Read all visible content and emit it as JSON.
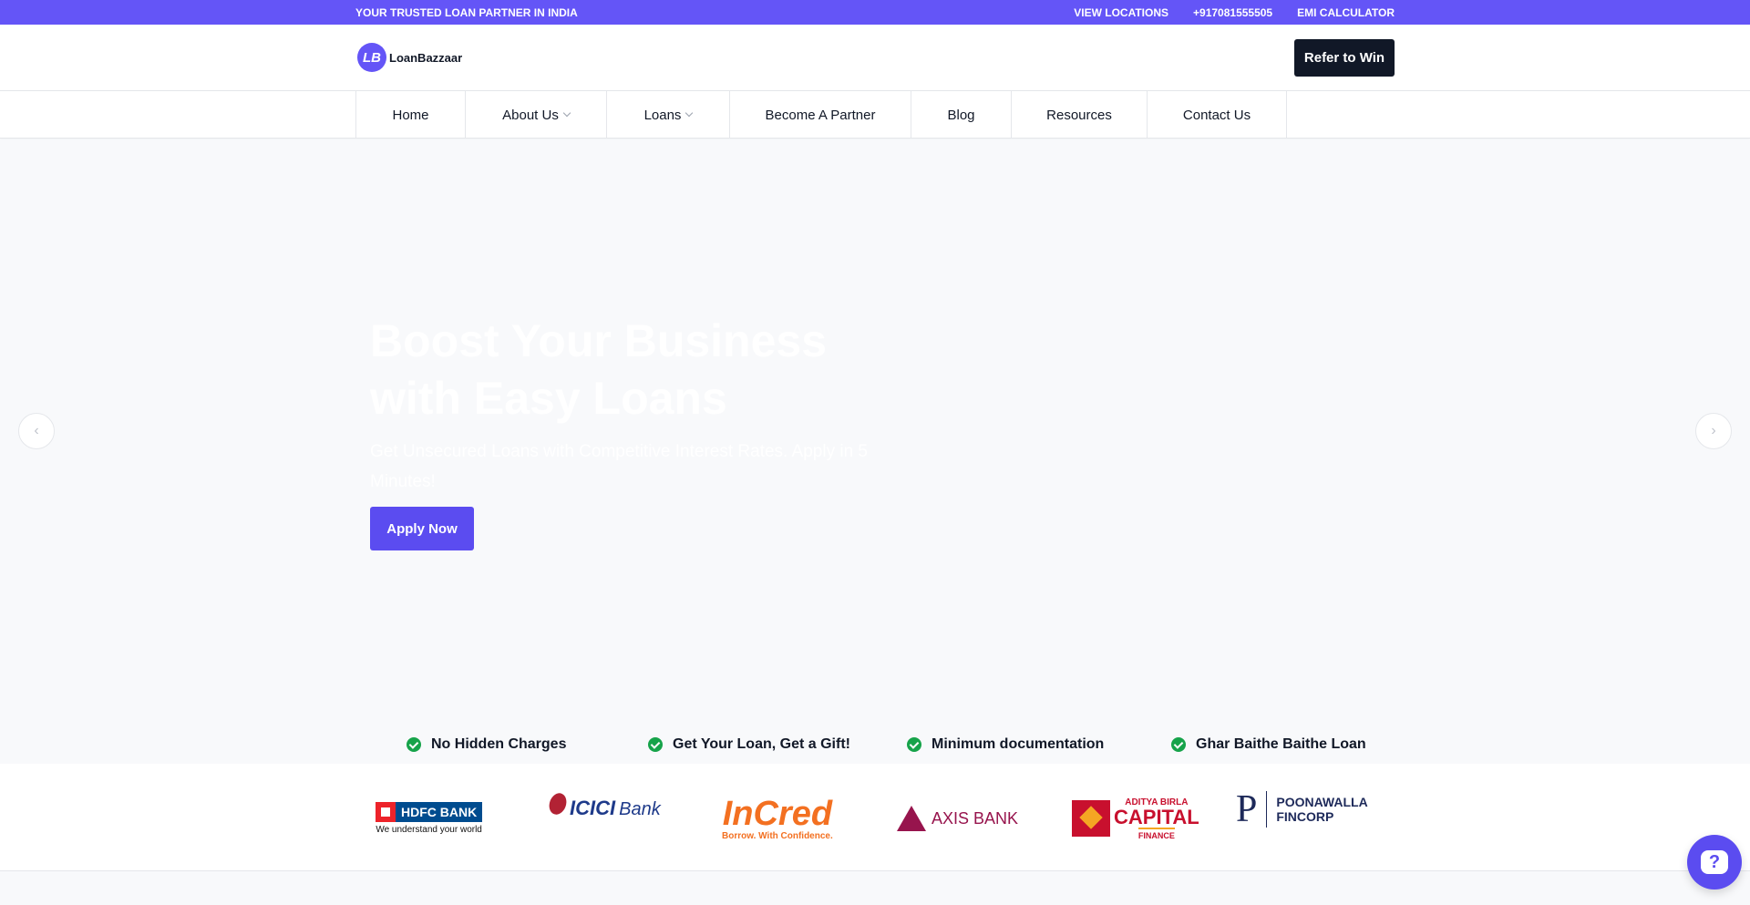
{
  "topbar": {
    "tagline": "YOUR TRUSTED LOAN PARTNER IN INDIA",
    "links": [
      "VIEW LOCATIONS",
      "+917081555505",
      "EMI CALCULATOR"
    ]
  },
  "header": {
    "logo_mark": "LB",
    "logo_text": "LoanBazzaar",
    "refer_label": "Refer to Win"
  },
  "nav": {
    "items": [
      {
        "label": "Home"
      },
      {
        "label": "About Us"
      },
      {
        "label": "Loans"
      },
      {
        "label": "Become A Partner"
      },
      {
        "label": "Blog"
      },
      {
        "label": "Resources"
      },
      {
        "label": "Contact Us"
      }
    ]
  },
  "hero": {
    "title": "Boost Your Business with Easy Loans",
    "subtitle": "Get Unsecured Loans with Competitive Interest Rates. Apply in 5 Minutes!",
    "apply_label": "Apply Now",
    "prev_icon": "‹",
    "next_icon": "›"
  },
  "features": [
    "No Hidden Charges",
    "Get Your Loan, Get a Gift!",
    "Minimum documentation",
    "Ghar Baithe Baithe Loan"
  ],
  "partners": {
    "hdfc": {
      "name": "HDFC BANK",
      "tag": "We understand your world"
    },
    "icici": {
      "name": "ICICI",
      "bank": "Bank"
    },
    "incred": {
      "name": "InCred",
      "tag": "Borrow. With Confidence."
    },
    "axis": {
      "name": "AXIS BANK"
    },
    "abc": {
      "line1": "ADITYA BIRLA",
      "line2": "CAPITAL",
      "line3": "FINANCE"
    },
    "poonawalla": {
      "mark": "P",
      "line1": "POONAWALLA",
      "line2": "FINCORP"
    }
  },
  "help": {
    "icon_glyph": "?"
  },
  "colors": {
    "brand": "#6455f7",
    "dark": "#111827",
    "check": "#16a34a"
  }
}
